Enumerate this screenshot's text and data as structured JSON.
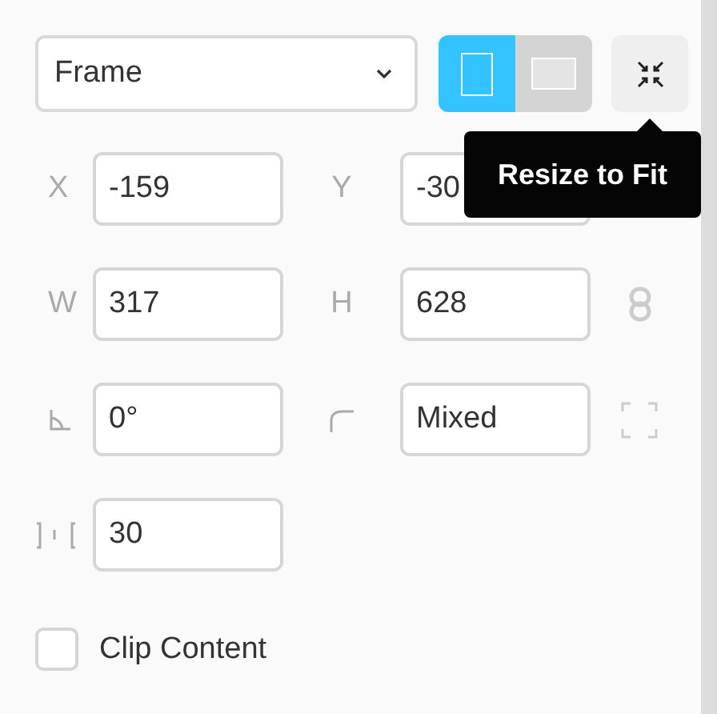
{
  "type_select": {
    "value": "Frame"
  },
  "orientation": [
    {
      "kind": "portrait",
      "selected": true
    },
    {
      "kind": "landscape",
      "selected": false
    }
  ],
  "resize_tooltip": "Resize to Fit",
  "rows": [
    {
      "cells": [
        {
          "kind": "label",
          "label": "X",
          "value": "-159"
        },
        {
          "kind": "label",
          "label": "Y",
          "value": "-30"
        }
      ]
    },
    {
      "cells": [
        {
          "kind": "label",
          "label": "W",
          "value": "317"
        },
        {
          "kind": "label",
          "label": "H",
          "value": "628"
        }
      ],
      "accessory": {
        "kind": "link"
      }
    },
    {
      "cells": [
        {
          "kind": "rotation",
          "value": "0°"
        },
        {
          "kind": "radius",
          "value": "Mixed"
        }
      ],
      "accessory": {
        "kind": "corners"
      }
    },
    {
      "cells": [
        {
          "kind": "gap",
          "value": "30"
        }
      ]
    }
  ],
  "clip_content": {
    "label": "Clip Content",
    "checked": false
  }
}
